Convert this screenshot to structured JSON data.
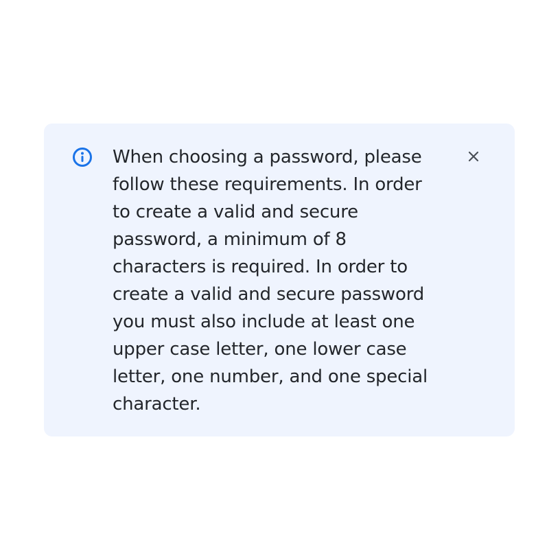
{
  "callout": {
    "icon": "info-icon",
    "message": "When choosing a password, please follow these requirements. In order to create a valid and secure password, a minimum of 8 characters is required. In order to create a valid and secure password you must also include at least one upper case letter, one lower case letter, one number, and one special character.",
    "close_icon": "close-icon"
  },
  "colors": {
    "background": "#eff4fe",
    "accent": "#1a73e8",
    "text": "#23262b",
    "close": "#4a4f57"
  }
}
